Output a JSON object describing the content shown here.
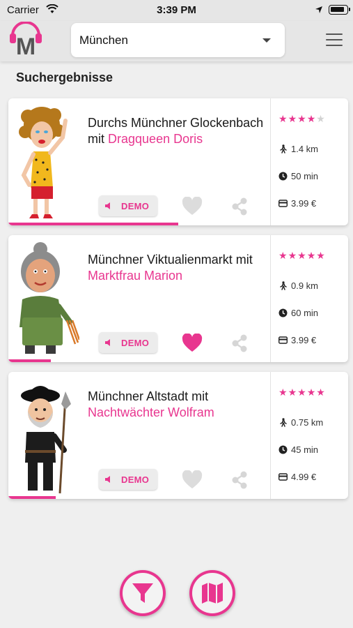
{
  "status_bar": {
    "carrier": "Carrier",
    "time": "3:39 PM"
  },
  "header": {
    "logo_letter": "M",
    "city_select": {
      "value": "München"
    }
  },
  "section_title": "Suchergebnisse",
  "accent_color": "#e8368f",
  "cards": [
    {
      "title": "Durchs Münchner Glockenbach mit",
      "guide": "Dragqueen Doris",
      "demo_label": "DEMO",
      "rating": 4,
      "rating_max": 5,
      "distance": "1.4 km",
      "duration": "50 min",
      "price": "3.99 €",
      "favorite": false,
      "progress": 0.5
    },
    {
      "title": "Münchner Viktualienmarkt mit",
      "guide": "Marktfrau Marion",
      "demo_label": "DEMO",
      "rating": 5,
      "rating_max": 5,
      "distance": "0.9 km",
      "duration": "60 min",
      "price": "3.99 €",
      "favorite": true,
      "progress": 0.125
    },
    {
      "title": "Münchner Altstadt mit",
      "guide": "Nachtwächter Wolfram",
      "demo_label": "DEMO",
      "rating": 5,
      "rating_max": 5,
      "distance": "0.75 km",
      "duration": "45 min",
      "price": "4.99 €",
      "favorite": false,
      "progress": 0.14
    }
  ],
  "icons": {
    "distance": "walking-person-icon",
    "duration": "clock-icon",
    "price": "wallet-icon",
    "demo": "speaker-icon",
    "favorite": "heart-icon",
    "share": "share-icon",
    "filter": "filter-icon",
    "map": "map-icon"
  }
}
